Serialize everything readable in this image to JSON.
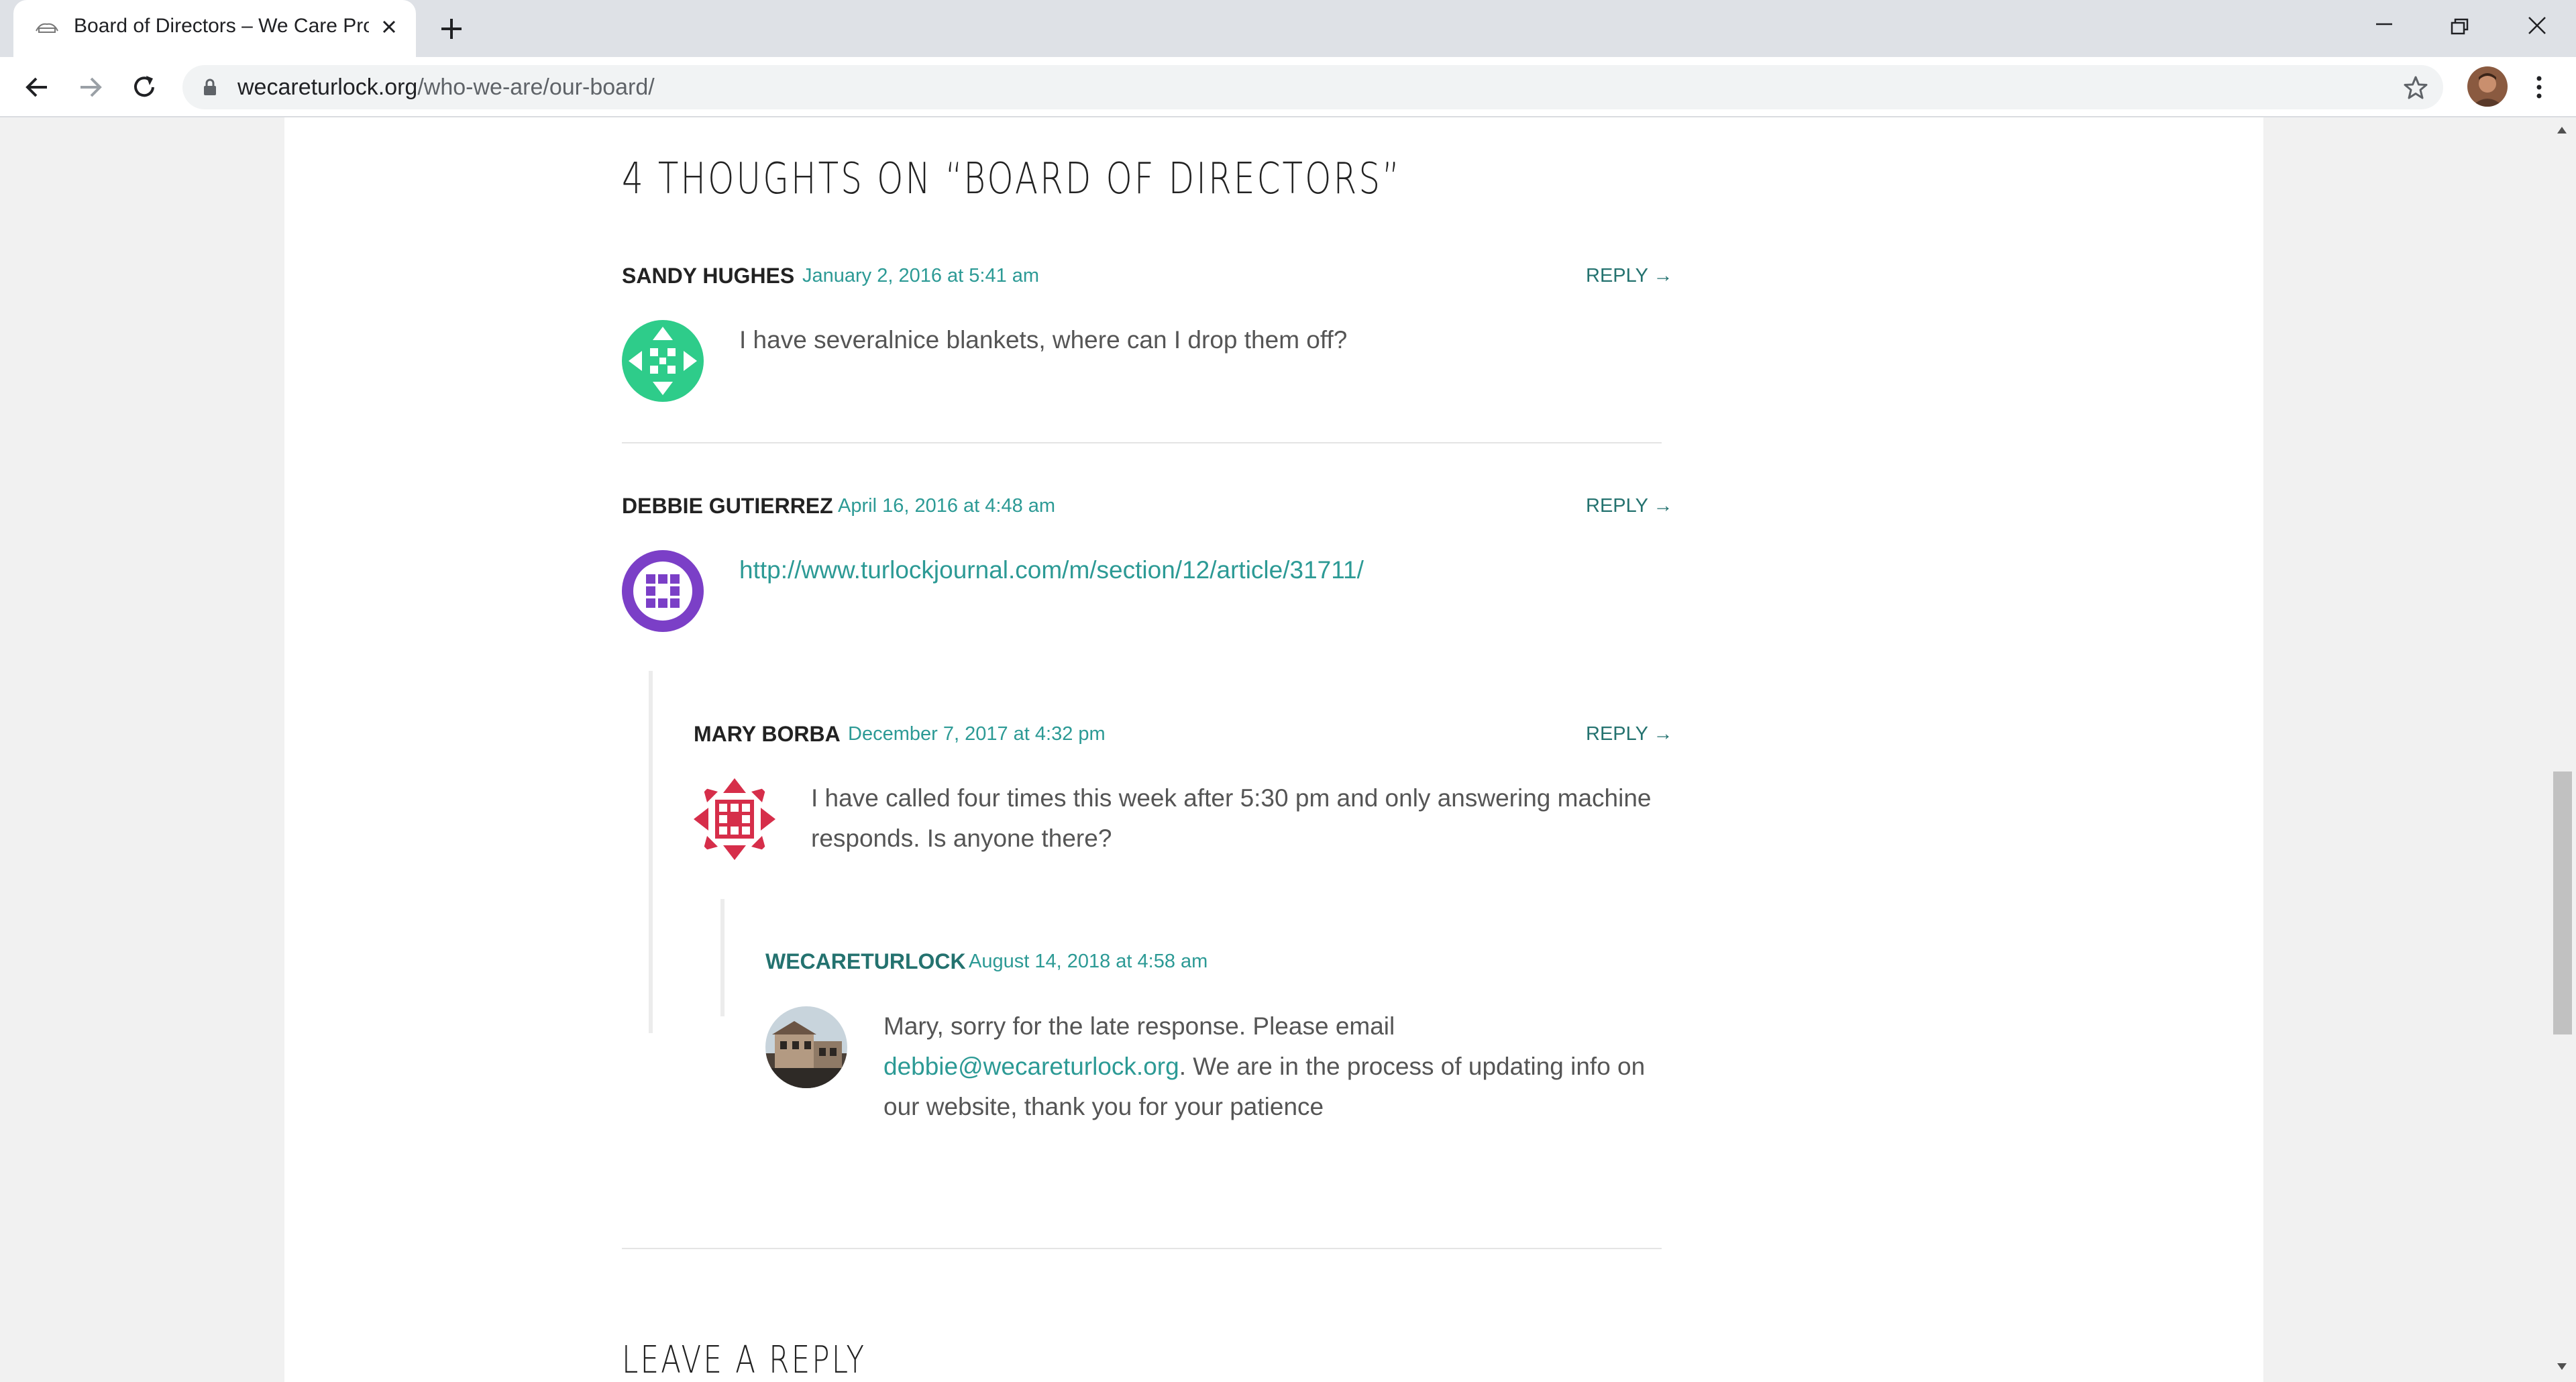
{
  "browser": {
    "tab_title": "Board of Directors – We Care Pro",
    "url_domain": "wecareturlock.org",
    "url_path": "/who-we-are/our-board/"
  },
  "comments_section": {
    "title": "4 THOUGHTS ON “BOARD OF DIRECTORS”",
    "reply_label": "REPLY →",
    "comments": [
      {
        "author": "SANDY HUGHES",
        "date": "January 2, 2016 at 5:41 am",
        "text": "I have severalnice blankets, where can I drop them off?",
        "avatar_color": "#2ecc8a"
      },
      {
        "author": "DEBBIE GUTIERREZ",
        "date": "April 16, 2016 at 4:48 am",
        "link": "http://www.turlockjournal.com/m/section/12/article/31711/",
        "avatar_color": "#7b3fc7"
      },
      {
        "author": "MARY BORBA",
        "date": "December 7, 2017 at 4:32 pm",
        "text": "I have called four times this week after 5:30 pm and only answering machine responds. Is anyone there?",
        "avatar_color": "#d62e4a"
      },
      {
        "author": "WECARETURLOCK",
        "date": "August 14, 2018 at 4:58 am",
        "text_before": "Mary, sorry for the late response. Please email",
        "email": "debbie@wecareturlock.org",
        "text_after": ". We are in the process of updating info on our website, thank you for your patience"
      }
    ]
  },
  "leave_reply": "LEAVE A REPLY",
  "colors": {
    "accent": "#2c9a95",
    "accent_dark": "#24726f"
  }
}
